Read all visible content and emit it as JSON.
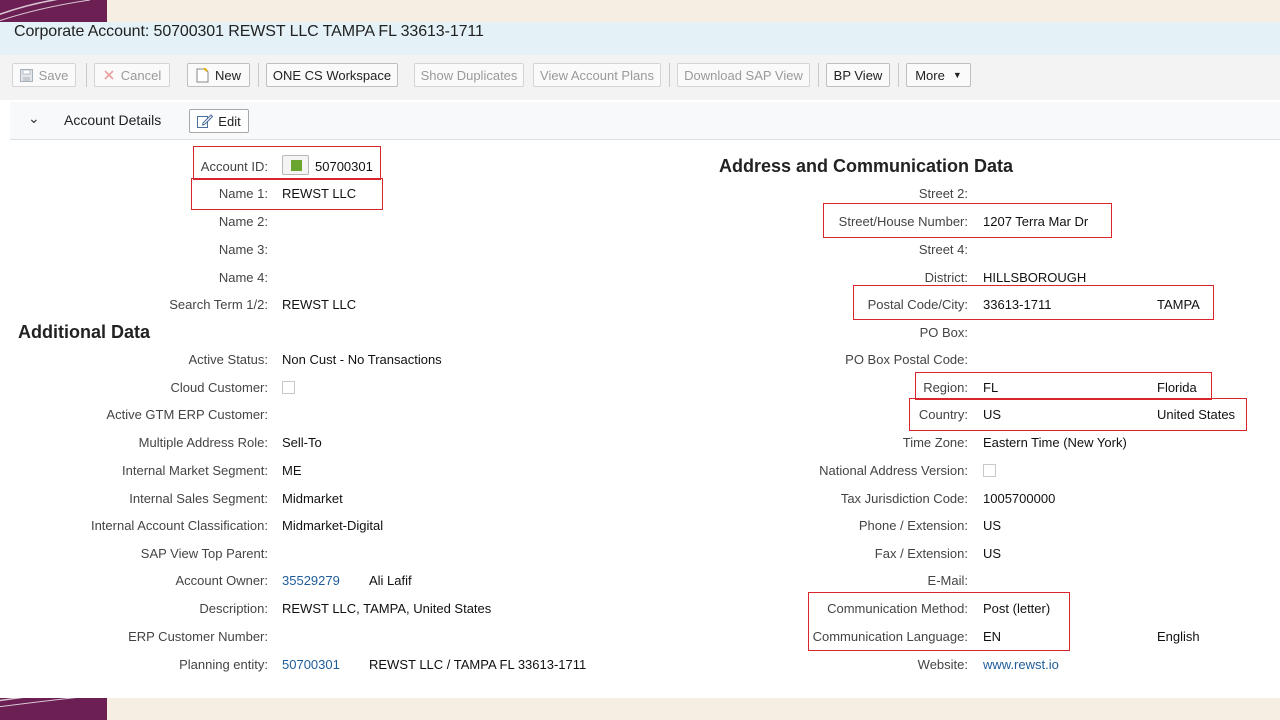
{
  "window": {
    "title": "Corporate Account: 50700301 REWST LLC TAMPA FL 33613-1711"
  },
  "toolbar": {
    "save": "Save",
    "cancel": "Cancel",
    "new": "New",
    "one_cs": "ONE CS Workspace",
    "show_duplicates": "Show Duplicates",
    "view_account_plans": "View Account Plans",
    "download_sap_view": "Download SAP View",
    "bp_view": "BP View",
    "more": "More"
  },
  "section": {
    "label": "Account Details",
    "edit": "Edit"
  },
  "left": {
    "account_id": {
      "label": "Account ID:",
      "value": "50700301",
      "status_color": "#6aa530"
    },
    "name1": {
      "label": "Name 1:",
      "value": "REWST LLC"
    },
    "name2": {
      "label": "Name 2:",
      "value": ""
    },
    "name3": {
      "label": "Name 3:",
      "value": ""
    },
    "name4": {
      "label": "Name 4:",
      "value": ""
    },
    "search_term": {
      "label": "Search Term 1/2:",
      "value": "REWST LLC"
    }
  },
  "additional": {
    "heading": "Additional Data",
    "active_status": {
      "label": "Active Status:",
      "value": "Non Cust - No Transactions"
    },
    "cloud_customer": {
      "label": "Cloud Customer:",
      "checked": false
    },
    "active_gtm": {
      "label": "Active GTM ERP Customer:",
      "value": ""
    },
    "multiple_address_role": {
      "label": "Multiple Address Role:",
      "value": "Sell-To"
    },
    "internal_market_segment": {
      "label": "Internal Market Segment:",
      "value": "ME"
    },
    "internal_sales_segment": {
      "label": "Internal Sales Segment:",
      "value": "Midmarket"
    },
    "internal_account_classification": {
      "label": "Internal Account Classification:",
      "value": "Midmarket-Digital"
    },
    "sap_view_top_parent": {
      "label": "SAP View Top Parent:",
      "value": ""
    },
    "account_owner": {
      "label": "Account Owner:",
      "id": "35529279",
      "name": "Ali Lafif"
    },
    "description": {
      "label": "Description:",
      "value": "REWST LLC, TAMPA, United States"
    },
    "erp_customer_number": {
      "label": "ERP Customer Number:",
      "value": ""
    },
    "planning_entity": {
      "label": "Planning entity:",
      "id": "50700301",
      "name": "REWST LLC / TAMPA FL 33613-1711"
    }
  },
  "address": {
    "heading": "Address and Communication Data",
    "street2": {
      "label": "Street 2:",
      "value": ""
    },
    "street_house": {
      "label": "Street/House Number:",
      "value": "1207 Terra Mar Dr"
    },
    "street4": {
      "label": "Street 4:",
      "value": ""
    },
    "district": {
      "label": "District:",
      "value": "HILLSBOROUGH"
    },
    "postal_city": {
      "label": "Postal Code/City:",
      "postal": "33613-1711",
      "city": "TAMPA"
    },
    "po_box": {
      "label": "PO Box:",
      "value": ""
    },
    "po_box_postal": {
      "label": "PO Box Postal Code:",
      "value": ""
    },
    "region": {
      "label": "Region:",
      "code": "FL",
      "name": "Florida"
    },
    "country": {
      "label": "Country:",
      "code": "US",
      "name": "United States"
    },
    "time_zone": {
      "label": "Time Zone:",
      "value": "Eastern Time (New York)"
    },
    "national_address_version": {
      "label": "National Address Version:",
      "checked": false
    },
    "tax_jurisdiction": {
      "label": "Tax Jurisdiction Code:",
      "value": "1005700000"
    },
    "phone": {
      "label": "Phone / Extension:",
      "value": "US"
    },
    "fax": {
      "label": "Fax / Extension:",
      "value": "US"
    },
    "email": {
      "label": "E-Mail:",
      "value": ""
    },
    "comm_method": {
      "label": "Communication Method:",
      "value": "Post (letter)"
    },
    "comm_language": {
      "label": "Communication Language:",
      "code": "EN",
      "name": "English"
    },
    "website": {
      "label": "Website:",
      "value": "www.rewst.io"
    }
  }
}
